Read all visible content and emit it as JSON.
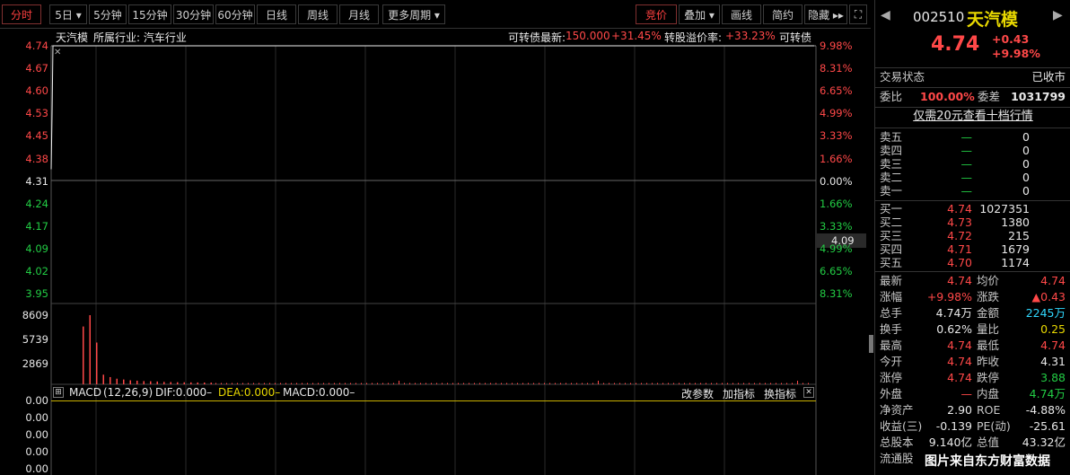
{
  "tabs": [
    {
      "label": "分时",
      "active": true
    },
    {
      "label": "5日 ▾"
    },
    {
      "label": "5分钟"
    },
    {
      "label": "15分钟"
    },
    {
      "label": "30分钟"
    },
    {
      "label": "60分钟"
    },
    {
      "label": "日线"
    },
    {
      "label": "周线"
    },
    {
      "label": "月线"
    },
    {
      "label": "更多周期 ▾"
    }
  ],
  "right_tabs": [
    {
      "label": "竞价",
      "active": true
    },
    {
      "label": "叠加 ▾"
    },
    {
      "label": "画线"
    },
    {
      "label": "简约"
    },
    {
      "label": "隐藏 ▸▸"
    }
  ],
  "info_bar": {
    "name": "天汽模",
    "industry": "所属行业: 汽车行业",
    "cb_label": "可转债最新:",
    "cb_price": "150.000",
    "cb_pct": "+31.45%",
    "premium_label": "转股溢价率:",
    "premium": "+33.23%",
    "cb_tag": "可转债"
  },
  "price_axis": [
    "4.74",
    "4.67",
    "4.60",
    "4.53",
    "4.45",
    "4.38",
    "4.31",
    "4.24",
    "4.17",
    "4.09",
    "4.02",
    "3.95"
  ],
  "pct_axis": [
    "9.98%",
    "8.31%",
    "6.65%",
    "4.99%",
    "3.33%",
    "1.66%",
    "0.00%",
    "1.66%",
    "3.33%",
    "4.99%",
    "6.65%",
    "8.31%"
  ],
  "cursor_price": "4.09",
  "vol_axis": [
    "8609",
    "5739",
    "2869"
  ],
  "macd_axis": [
    "0.00",
    "0.00",
    "0.00",
    "0.00",
    "0.00"
  ],
  "macd_bar": {
    "title": "MACD",
    "params": "(12,26,9)",
    "dif": "DIF:0.000–",
    "dea": "DEA:0.000–",
    "macd": "MACD:0.000–",
    "btn1": "改参数",
    "btn2": "加指标",
    "btn3": "换指标"
  },
  "chart_data": {
    "type": "line",
    "price_series": [
      4.31,
      4.5,
      4.74,
      4.74,
      4.74
    ],
    "price_range": [
      3.88,
      4.74
    ],
    "volume": [
      7200,
      8609,
      5200,
      1200,
      900,
      700,
      600,
      500,
      450,
      400,
      380,
      350,
      300,
      280,
      260,
      250,
      240,
      230,
      220,
      210
    ],
    "volume_range": [
      0,
      8609
    ]
  },
  "panel": {
    "code": "002510",
    "name": "天汽模",
    "price": "4.74",
    "change": "+0.43",
    "pct": "+9.98%",
    "status_label": "交易状态",
    "status": "已收市",
    "wb_label": "委比",
    "wb": "100.00%",
    "wc_label": "委差",
    "wc": "1031799",
    "link": "仅需20元查看十档行情",
    "sells": [
      {
        "k": "卖五",
        "p": "—",
        "v": "0"
      },
      {
        "k": "卖四",
        "p": "—",
        "v": "0"
      },
      {
        "k": "卖三",
        "p": "—",
        "v": "0"
      },
      {
        "k": "卖二",
        "p": "—",
        "v": "0"
      },
      {
        "k": "卖一",
        "p": "—",
        "v": "0"
      }
    ],
    "buys": [
      {
        "k": "买一",
        "p": "4.74",
        "v": "1027351"
      },
      {
        "k": "买二",
        "p": "4.73",
        "v": "1380"
      },
      {
        "k": "买三",
        "p": "4.72",
        "v": "215"
      },
      {
        "k": "买四",
        "p": "4.71",
        "v": "1679"
      },
      {
        "k": "买五",
        "p": "4.70",
        "v": "1174"
      }
    ],
    "stats": [
      {
        "k1": "最新",
        "v1": "4.74",
        "c1": "red",
        "k2": "均价",
        "v2": "4.74",
        "c2": "red"
      },
      {
        "k1": "涨幅",
        "v1": "+9.98%",
        "c1": "red",
        "k2": "涨跌",
        "v2": "▲0.43",
        "c2": "red"
      },
      {
        "k1": "总手",
        "v1": "4.74万",
        "c1": "white",
        "k2": "金额",
        "v2": "2245万",
        "c2": "cyan"
      },
      {
        "k1": "换手",
        "v1": "0.62%",
        "c1": "white",
        "k2": "量比",
        "v2": "0.25",
        "c2": "yellow"
      },
      {
        "k1": "最高",
        "v1": "4.74",
        "c1": "red",
        "k2": "最低",
        "v2": "4.74",
        "c2": "red"
      },
      {
        "k1": "今开",
        "v1": "4.74",
        "c1": "red",
        "k2": "昨收",
        "v2": "4.31",
        "c2": "white"
      },
      {
        "k1": "涨停",
        "v1": "4.74",
        "c1": "red",
        "k2": "跌停",
        "v2": "3.88",
        "c2": "green"
      },
      {
        "k1": "外盘",
        "v1": "—",
        "c1": "red",
        "k2": "内盘",
        "v2": "4.74万",
        "c2": "green"
      },
      {
        "k1": "净资产",
        "v1": "2.90",
        "c1": "white",
        "k2": "ROE",
        "v2": "-4.88%",
        "c2": "white"
      },
      {
        "k1": "收益(三)",
        "v1": "-0.139",
        "c1": "white",
        "k2": "PE(动)",
        "v2": "-25.61",
        "c2": "white"
      },
      {
        "k1": "总股本",
        "v1": "9.140亿",
        "c1": "white",
        "k2": "总值",
        "v2": "43.32亿",
        "c2": "white"
      },
      {
        "k1": "流通股",
        "v1": "",
        "c1": "white",
        "k2": "",
        "v2": "",
        "c2": "white"
      }
    ],
    "watermark": "图片来自东方财富数据"
  }
}
